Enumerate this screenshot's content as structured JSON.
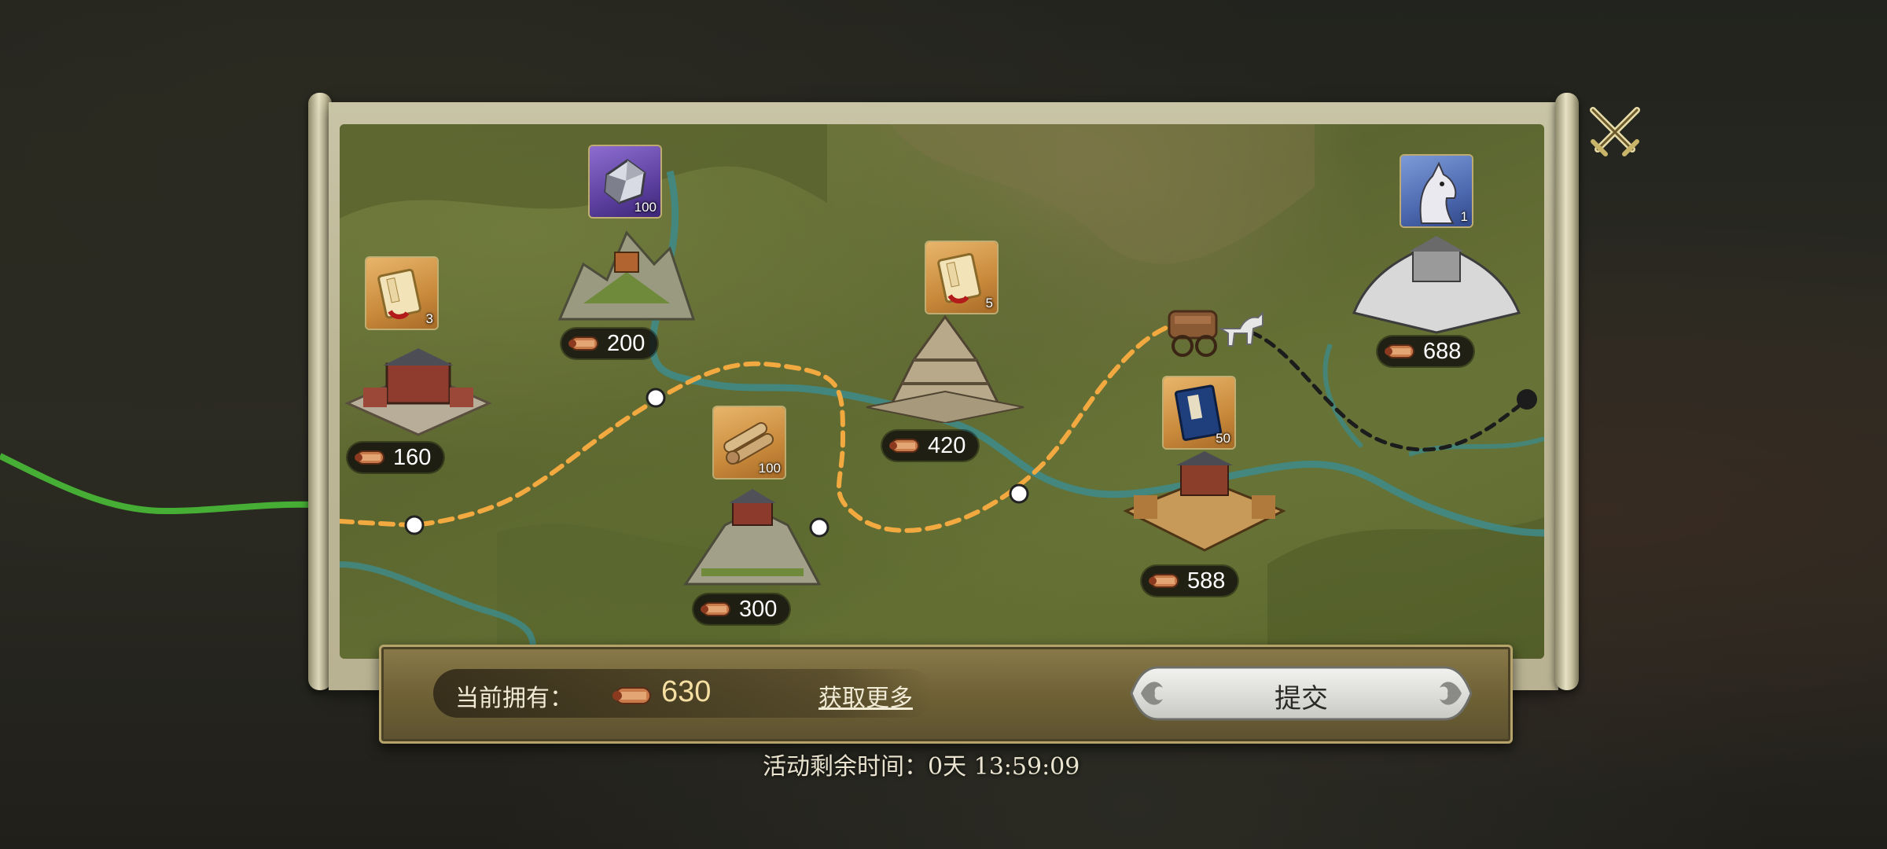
{
  "event": {
    "currency_name": "scroll-token",
    "nodes": [
      {
        "id": "node-1",
        "cost": "160",
        "reward_icon": "book-icon",
        "reward_qty": "3",
        "reward_frame": "gold"
      },
      {
        "id": "node-2",
        "cost": "200",
        "reward_icon": "ore-crystal-icon",
        "reward_qty": "100",
        "reward_frame": "purple"
      },
      {
        "id": "node-3",
        "cost": "300",
        "reward_icon": "scroll-bundle-icon",
        "reward_qty": "100",
        "reward_frame": "gold"
      },
      {
        "id": "node-4",
        "cost": "420",
        "reward_icon": "book-icon",
        "reward_qty": "5",
        "reward_frame": "gold"
      },
      {
        "id": "node-5",
        "cost": "588",
        "reward_icon": "blue-book-icon",
        "reward_qty": "50",
        "reward_frame": "gold"
      },
      {
        "id": "node-6",
        "cost": "688",
        "reward_icon": "white-horse-icon",
        "reward_qty": "1",
        "reward_frame": "blue"
      }
    ]
  },
  "footer": {
    "owned_label": "当前拥有：",
    "owned_value": "630",
    "get_more_label": "获取更多",
    "submit_label": "提交"
  },
  "timer_text": "活动剩余时间：0天  13:59:09",
  "colors": {
    "path_orange": "#f2a93f",
    "path_pending": "#1c1c1c",
    "gold_text": "#f6dfa2"
  }
}
